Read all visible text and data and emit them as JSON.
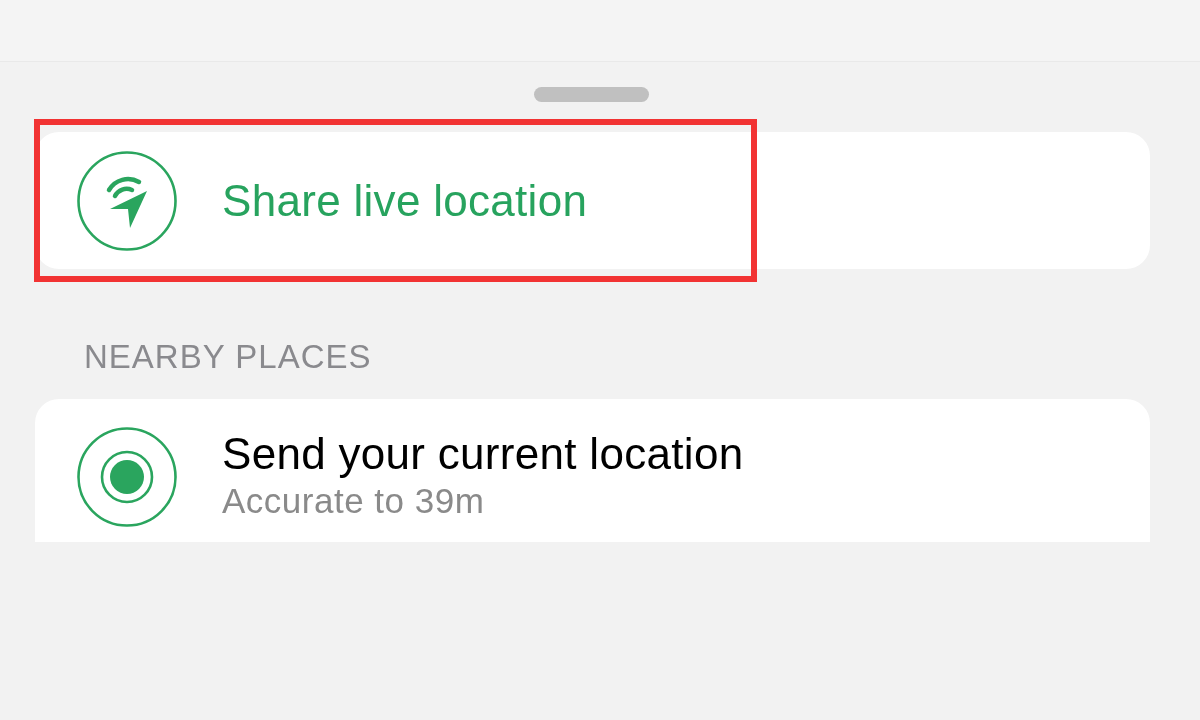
{
  "live_location": {
    "label": "Share live location",
    "highlighted": true
  },
  "nearby_places": {
    "heading": "NEARBY PLACES",
    "items": [
      {
        "kind": "current",
        "title": "Send your current location",
        "subtitle": "Accurate to 39m"
      }
    ]
  }
}
